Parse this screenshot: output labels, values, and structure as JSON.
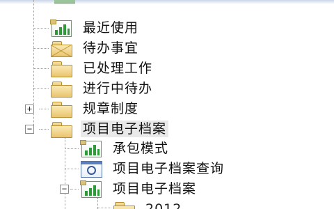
{
  "tree": {
    "items": [
      {
        "label": "最近使用",
        "icon": "report-icon"
      },
      {
        "label": "待办事宜",
        "icon": "mail-folder-icon"
      },
      {
        "label": "已处理工作",
        "icon": "folder-icon"
      },
      {
        "label": "进行中待办",
        "icon": "folder-icon"
      },
      {
        "label": "规章制度",
        "icon": "folder-icon",
        "expander": "+"
      },
      {
        "label": "项目电子档案",
        "icon": "folder-icon",
        "expander": "−",
        "selected": true
      },
      {
        "label": "承包模式",
        "icon": "report-icon"
      },
      {
        "label": "项目电子档案查询",
        "icon": "query-window-icon"
      },
      {
        "label": "项目电子档案",
        "icon": "report-icon",
        "expander": "−"
      },
      {
        "label": "2012",
        "icon": "folder-icon"
      }
    ]
  }
}
